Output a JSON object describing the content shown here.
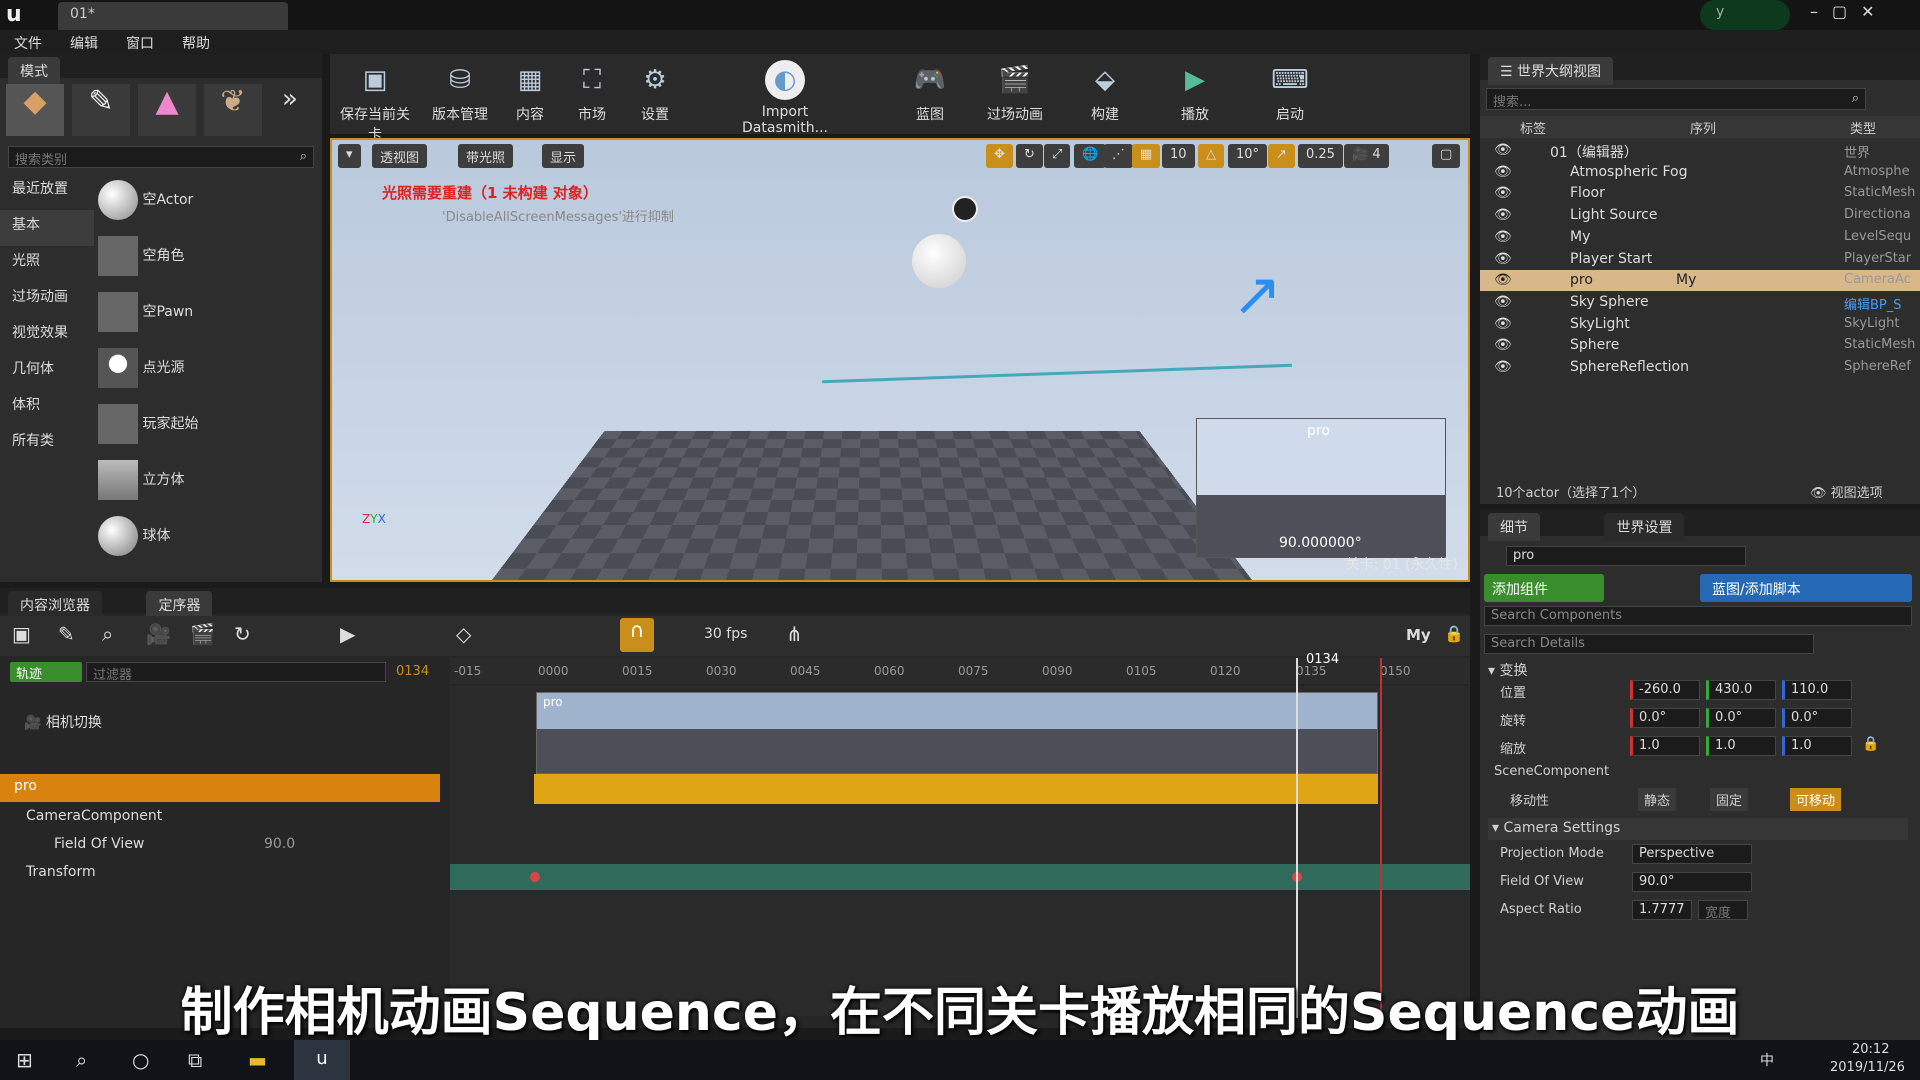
{
  "window": {
    "logo": "u",
    "doc_tab": "01*",
    "user": "y"
  },
  "menu": [
    "文件",
    "编辑",
    "窗口",
    "帮助"
  ],
  "modes": {
    "tab": "模式",
    "search_placeholder": "搜索类别",
    "categories": [
      "最近放置",
      "基本",
      "光照",
      "过场动画",
      "视觉效果",
      "几何体",
      "体积",
      "所有类"
    ],
    "items": [
      "空Actor",
      "空角色",
      "空Pawn",
      "点光源",
      "玩家起始",
      "立方体",
      "球体"
    ]
  },
  "toolbar": [
    "保存当前关卡",
    "版本管理",
    "内容",
    "市场",
    "设置",
    "Import Datasmith...",
    "蓝图",
    "过场动画",
    "构建",
    "播放",
    "启动"
  ],
  "viewport": {
    "view_mode": "透视图",
    "lit": "带光照",
    "show": "显示",
    "grid": "10",
    "rot": "10°",
    "scale": "0.25",
    "cam_speed": "4",
    "warn1": "光照需要重建（1 未构建 对象）",
    "warn2": "'DisableAllScreenMessages'进行抑制",
    "pip_name": "pro",
    "pip_fov": "90.000000°",
    "level": "关卡: 01 (永久性)"
  },
  "outliner": {
    "tab": "世界大纲视图",
    "search_placeholder": "搜索...",
    "cols": [
      "标签",
      "序列",
      "类型"
    ],
    "items": [
      {
        "label": "01（编辑器）",
        "seq": "",
        "type": "世界"
      },
      {
        "label": "Atmospheric Fog",
        "seq": "",
        "type": "Atmosphe"
      },
      {
        "label": "Floor",
        "seq": "",
        "type": "StaticMesh"
      },
      {
        "label": "Light Source",
        "seq": "",
        "type": "Directiona"
      },
      {
        "label": "My",
        "seq": "",
        "type": "LevelSequ"
      },
      {
        "label": "Player Start",
        "seq": "",
        "type": "PlayerStar"
      },
      {
        "label": "pro",
        "seq": "My",
        "type": "CameraAc"
      },
      {
        "label": "Sky Sphere",
        "seq": "",
        "type": "编辑BP_S"
      },
      {
        "label": "SkyLight",
        "seq": "",
        "type": "SkyLight"
      },
      {
        "label": "Sphere",
        "seq": "",
        "type": "StaticMesh"
      },
      {
        "label": "SphereReflection",
        "seq": "",
        "type": "SphereRef"
      }
    ],
    "status": "10个actor（选择了1个）",
    "view_options": "视图选项"
  },
  "details": {
    "tab1": "细节",
    "tab2": "世界设置",
    "name": "pro",
    "add_comp": "添加组件",
    "blueprint": "蓝图/添加脚本",
    "search_comp": "Search Components",
    "search_details": "Search Details",
    "transform": "变换",
    "loc_label": "位置",
    "rot_label": "旋转",
    "scale_label": "缩放",
    "loc": [
      "-260.0",
      "430.0",
      "110.0"
    ],
    "rot": [
      "0.0°",
      "0.0°",
      "0.0°"
    ],
    "scale": [
      "1.0",
      "1.0",
      "1.0"
    ],
    "scene_comp": "SceneComponent",
    "mobility": "移动性",
    "mob_opts": [
      "静态",
      "固定",
      "可移动"
    ],
    "cam_settings": "Camera Settings",
    "proj_label": "Projection Mode",
    "proj_val": "Perspective",
    "fov_label": "Field Of View",
    "fov_val": "90.0°",
    "aspect_label": "Aspect Ratio",
    "aspect_val": "1.7777",
    "aspect_extra": "宽度"
  },
  "sequencer": {
    "tab1": "内容浏览器",
    "tab2": "定序器",
    "fps": "30 fps",
    "seq_name": "My",
    "track_btn": "轨迹",
    "filter": "过滤器",
    "frame": "0134",
    "ticks": [
      "-015",
      "0000",
      "0015",
      "0030",
      "0045",
      "0060",
      "0075",
      "0090",
      "0105",
      "0120",
      "0135",
      "0150"
    ],
    "tracks": {
      "cam_cut": "相机切换",
      "actor": "pro",
      "comp": "CameraComponent",
      "fov": "Field Of View",
      "fov_val": "90.0",
      "transform": "Transform"
    },
    "shot": "pro"
  },
  "subtitle": "制作相机动画Sequence，在不同关卡播放相同的Sequence动画",
  "taskbar": {
    "time": "20:12",
    "date": "2019/11/26",
    "ime": "中"
  }
}
